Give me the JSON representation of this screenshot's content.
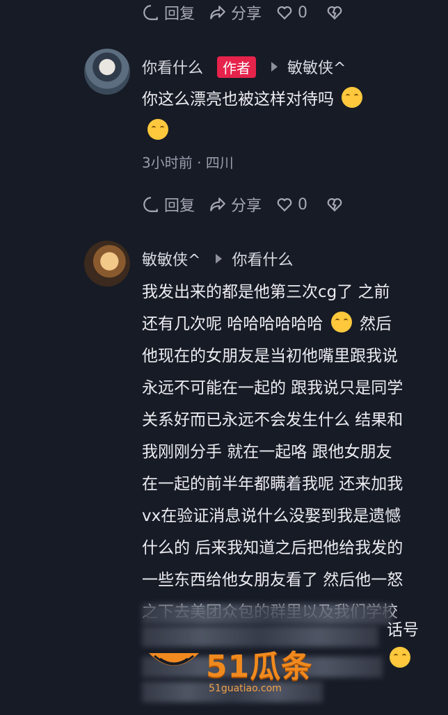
{
  "top_actions": {
    "reply": "回复",
    "share": "分享",
    "likes": "0"
  },
  "comment1": {
    "username": "你看什么",
    "badge": "作者",
    "reply_to": "敏敏侠^",
    "text": "你这么漂亮也被这样对待吗",
    "time_location": "3小时前 · 四川",
    "actions": {
      "reply": "回复",
      "share": "分享",
      "likes": "0"
    }
  },
  "comment2": {
    "username": "敏敏侠^",
    "reply_to": "你看什么",
    "lines": [
      "我发出来的都是他第三次cg了 之前",
      "还有几次呢 哈哈哈哈哈哈",
      "他现在的女朋友是当初他嘴里跟我说",
      "永远不可能在一起的 跟我说只是同学",
      "关系好而已永远不会发生什么 结果和",
      "我刚刚分手 就在一起咯 跟他女朋友",
      "在一起的前半年都瞒着我呢 还来加我",
      "vx在验证消息说什么没娶到我是遗憾",
      "什么的 后来我知道之后把他给我发的",
      "一些东西给他女朋友看了 然后他一怒",
      "之下去美团众包的群里以及我们学校"
    ],
    "line2_tail": "然后",
    "partial_visible": "话号"
  },
  "watermark": {
    "brand": "51瓜条",
    "url": "51guatiao.com"
  },
  "colors": {
    "background": "#171b26",
    "badge": "#e5234b",
    "watermark": "#f08a1f"
  },
  "icons": [
    "reply-icon",
    "share-icon",
    "like-icon",
    "dislike-icon"
  ]
}
